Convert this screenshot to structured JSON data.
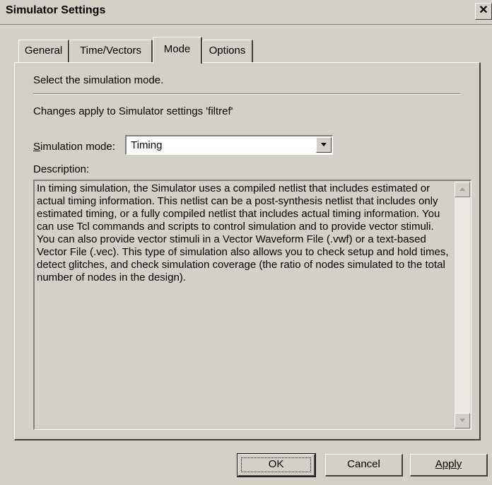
{
  "window": {
    "title": "Simulator Settings",
    "close_symbol": "✕"
  },
  "tabs": [
    {
      "label": "General",
      "active": false
    },
    {
      "label": "Time/Vectors",
      "active": false
    },
    {
      "label": "Mode",
      "active": true
    },
    {
      "label": "Options",
      "active": false
    }
  ],
  "panel": {
    "instruction": "Select the simulation mode.",
    "changes_text": "Changes apply to Simulator settings 'filtref'",
    "mode_label_mnemonic": "S",
    "mode_label_rest": "imulation mode:",
    "mode_value": "Timing",
    "description_label": "Description:",
    "description_text": "In timing simulation, the Simulator uses a compiled netlist that includes estimated or actual timing information. This netlist can be a post-synthesis netlist that includes only estimated timing, or a fully compiled netlist that includes actual timing information.  You can use Tcl commands and scripts to control simulation and to provide vector stimuli. You can also provide vector stimuli in a Vector Waveform File (.vwf) or a text-based Vector File (.vec). This type of simulation also allows you to check setup and hold times, detect glitches, and check simulation coverage (the ratio of nodes simulated to the total number of nodes in the design)."
  },
  "buttons": {
    "ok": "OK",
    "cancel": "Cancel",
    "apply": "Apply"
  },
  "icons": {
    "close": "close-icon",
    "dropdown": "chevron-down-icon",
    "scroll_up": "scroll-up-arrow-icon",
    "scroll_down": "scroll-down-arrow-icon"
  }
}
